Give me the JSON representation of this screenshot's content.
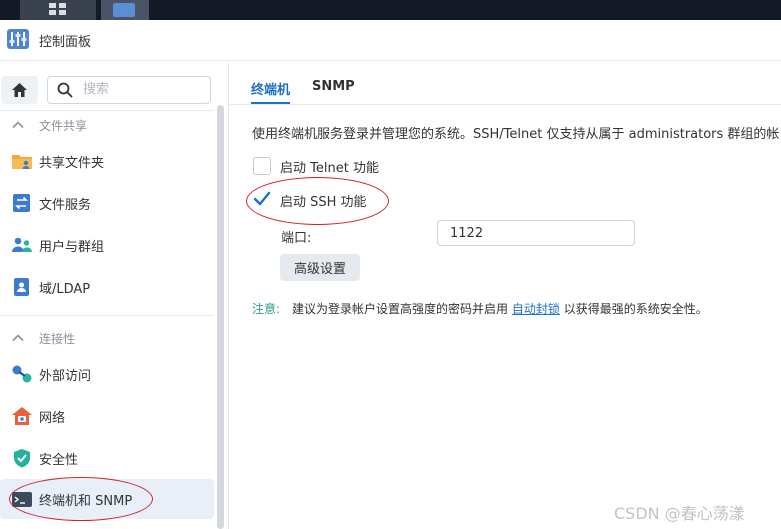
{
  "app": {
    "title": "控制面板"
  },
  "sidebar": {
    "search_placeholder": "搜索",
    "sections": [
      {
        "label": "文件共享",
        "items": [
          {
            "label": "共享文件夹",
            "icon": "shared-folder-icon"
          },
          {
            "label": "文件服务",
            "icon": "file-services-icon"
          },
          {
            "label": "用户与群组",
            "icon": "users-groups-icon"
          },
          {
            "label": "域/LDAP",
            "icon": "domain-ldap-icon"
          }
        ]
      },
      {
        "label": "连接性",
        "items": [
          {
            "label": "外部访问",
            "icon": "external-access-icon"
          },
          {
            "label": "网络",
            "icon": "network-icon"
          },
          {
            "label": "安全性",
            "icon": "security-shield-icon"
          },
          {
            "label": "终端机和 SNMP",
            "icon": "terminal-icon",
            "active": true
          }
        ]
      }
    ]
  },
  "main": {
    "tabs": [
      {
        "label": "终端机",
        "active": true
      },
      {
        "label": "SNMP",
        "active": false
      }
    ],
    "description": "使用终端机服务登录并管理您的系统。SSH/Telnet 仅支持从属于 administrators 群组的帐",
    "telnet": {
      "label": "启动 Telnet 功能",
      "checked": false
    },
    "ssh": {
      "label": "启动 SSH 功能",
      "checked": true
    },
    "port": {
      "label": "端口:",
      "value": "1122"
    },
    "advanced_button": "高级设置",
    "note": {
      "label": "注意:",
      "text_before": "建议为登录帐户设置高强度的密码并启用",
      "link": "自动封锁",
      "text_after": "以获得最强的系统安全性。"
    }
  },
  "watermark": "CSDN @春心荡漾",
  "colors": {
    "accent": "#1f6fc5",
    "annotation": "#d0202a",
    "note": "#2a9a8a",
    "taskbar": "#131a26"
  }
}
